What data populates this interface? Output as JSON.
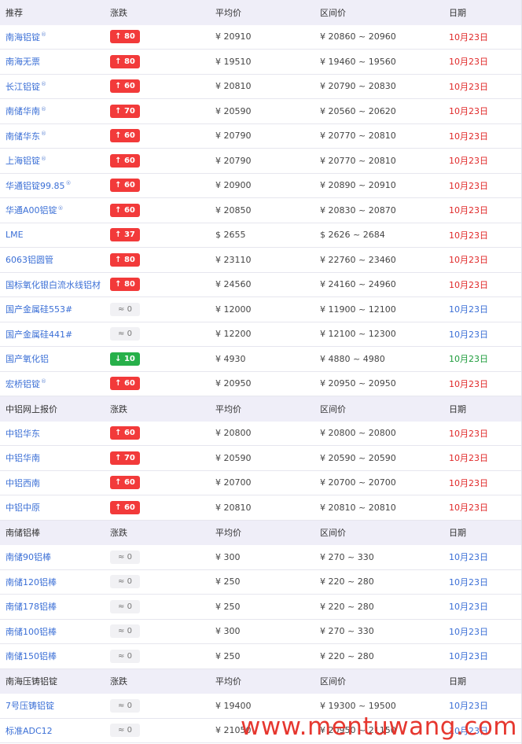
{
  "watermark": "www.mentuwang.com",
  "colors": {
    "up": "#f23a3a",
    "down": "#27b04a",
    "flat": "#f1f1f4",
    "link": "#3b6fd6",
    "header_bg": "#efeef8"
  },
  "sections": [
    {
      "title": "推荐",
      "columns": [
        "涨跌",
        "平均价",
        "区间价",
        "日期"
      ],
      "rows": [
        {
          "name": "南海铝锭",
          "mark": "®",
          "change": "↑ 80",
          "dir": "up",
          "avg": "¥  20910",
          "range": "¥  20860 ~ 20960",
          "date": "10月23日"
        },
        {
          "name": "南海无票",
          "mark": "",
          "change": "↑ 80",
          "dir": "up",
          "avg": "¥  19510",
          "range": "¥  19460 ~ 19560",
          "date": "10月23日"
        },
        {
          "name": "长江铝锭",
          "mark": "®",
          "change": "↑ 60",
          "dir": "up",
          "avg": "¥  20810",
          "range": "¥  20790 ~ 20830",
          "date": "10月23日"
        },
        {
          "name": "南储华南",
          "mark": "®",
          "change": "↑ 70",
          "dir": "up",
          "avg": "¥  20590",
          "range": "¥  20560 ~ 20620",
          "date": "10月23日"
        },
        {
          "name": "南储华东",
          "mark": "®",
          "change": "↑ 60",
          "dir": "up",
          "avg": "¥  20790",
          "range": "¥  20770 ~ 20810",
          "date": "10月23日"
        },
        {
          "name": "上海铝锭",
          "mark": "®",
          "change": "↑ 60",
          "dir": "up",
          "avg": "¥  20790",
          "range": "¥  20770 ~ 20810",
          "date": "10月23日"
        },
        {
          "name": "华通铝锭99.85",
          "mark": "®",
          "change": "↑ 60",
          "dir": "up",
          "avg": "¥  20900",
          "range": "¥  20890 ~ 20910",
          "date": "10月23日"
        },
        {
          "name": "华通A00铝锭",
          "mark": "®",
          "change": "↑ 60",
          "dir": "up",
          "avg": "¥  20850",
          "range": "¥  20830 ~ 20870",
          "date": "10月23日"
        },
        {
          "name": "LME",
          "mark": "",
          "change": "↑ 37",
          "dir": "up",
          "avg": "$  2655",
          "range": "$  2626 ~ 2684",
          "date": "10月23日"
        },
        {
          "name": "6063铝圆管",
          "mark": "",
          "change": "↑ 80",
          "dir": "up",
          "avg": "¥  23110",
          "range": "¥  22760 ~ 23460",
          "date": "10月23日"
        },
        {
          "name": "国标氧化银白流水线铝材",
          "mark": "",
          "change": "↑ 80",
          "dir": "up",
          "avg": "¥  24560",
          "range": "¥  24160 ~ 24960",
          "date": "10月23日"
        },
        {
          "name": "国产金属硅553#",
          "mark": "",
          "change": "≈ 0",
          "dir": "flat",
          "avg": "¥  12000",
          "range": "¥  11900 ~ 12100",
          "date": "10月23日"
        },
        {
          "name": "国产金属硅441#",
          "mark": "",
          "change": "≈ 0",
          "dir": "flat",
          "avg": "¥  12200",
          "range": "¥  12100 ~ 12300",
          "date": "10月23日"
        },
        {
          "name": "国产氧化铝",
          "mark": "",
          "change": "↓ 10",
          "dir": "down",
          "avg": "¥  4930",
          "range": "¥  4880 ~ 4980",
          "date": "10月23日"
        },
        {
          "name": "宏桥铝锭",
          "mark": "®",
          "change": "↑ 60",
          "dir": "up",
          "avg": "¥  20950",
          "range": "¥  20950 ~ 20950",
          "date": "10月23日"
        }
      ]
    },
    {
      "title": "中铝网上报价",
      "columns": [
        "涨跌",
        "平均价",
        "区间价",
        "日期"
      ],
      "rows": [
        {
          "name": "中铝华东",
          "mark": "",
          "change": "↑ 60",
          "dir": "up",
          "avg": "¥  20800",
          "range": "¥  20800 ~ 20800",
          "date": "10月23日"
        },
        {
          "name": "中铝华南",
          "mark": "",
          "change": "↑ 70",
          "dir": "up",
          "avg": "¥  20590",
          "range": "¥  20590 ~ 20590",
          "date": "10月23日"
        },
        {
          "name": "中铝西南",
          "mark": "",
          "change": "↑ 60",
          "dir": "up",
          "avg": "¥  20700",
          "range": "¥  20700 ~ 20700",
          "date": "10月23日"
        },
        {
          "name": "中铝中原",
          "mark": "",
          "change": "↑ 60",
          "dir": "up",
          "avg": "¥  20810",
          "range": "¥  20810 ~ 20810",
          "date": "10月23日"
        }
      ]
    },
    {
      "title": "南储铝棒",
      "columns": [
        "涨跌",
        "平均价",
        "区间价",
        "日期"
      ],
      "rows": [
        {
          "name": "南储90铝棒",
          "mark": "",
          "change": "≈ 0",
          "dir": "flat",
          "avg": "¥  300",
          "range": "¥  270 ~ 330",
          "date": "10月23日"
        },
        {
          "name": "南储120铝棒",
          "mark": "",
          "change": "≈ 0",
          "dir": "flat",
          "avg": "¥  250",
          "range": "¥  220 ~ 280",
          "date": "10月23日"
        },
        {
          "name": "南储178铝棒",
          "mark": "",
          "change": "≈ 0",
          "dir": "flat",
          "avg": "¥  250",
          "range": "¥  220 ~ 280",
          "date": "10月23日"
        },
        {
          "name": "南储100铝棒",
          "mark": "",
          "change": "≈ 0",
          "dir": "flat",
          "avg": "¥  300",
          "range": "¥  270 ~ 330",
          "date": "10月23日"
        },
        {
          "name": "南储150铝棒",
          "mark": "",
          "change": "≈ 0",
          "dir": "flat",
          "avg": "¥  250",
          "range": "¥  220 ~ 280",
          "date": "10月23日"
        }
      ]
    },
    {
      "title": "南海压铸铝锭",
      "columns": [
        "涨跌",
        "平均价",
        "区间价",
        "日期"
      ],
      "rows": [
        {
          "name": "7号压铸铝锭",
          "mark": "",
          "change": "≈ 0",
          "dir": "flat",
          "avg": "¥  19400",
          "range": "¥  19300 ~ 19500",
          "date": "10月23日"
        },
        {
          "name": "标准ADC12",
          "mark": "",
          "change": "≈ 0",
          "dir": "flat",
          "avg": "¥  21050",
          "range": "¥  20950 ~ 21150",
          "date": "10月23日"
        }
      ]
    }
  ]
}
